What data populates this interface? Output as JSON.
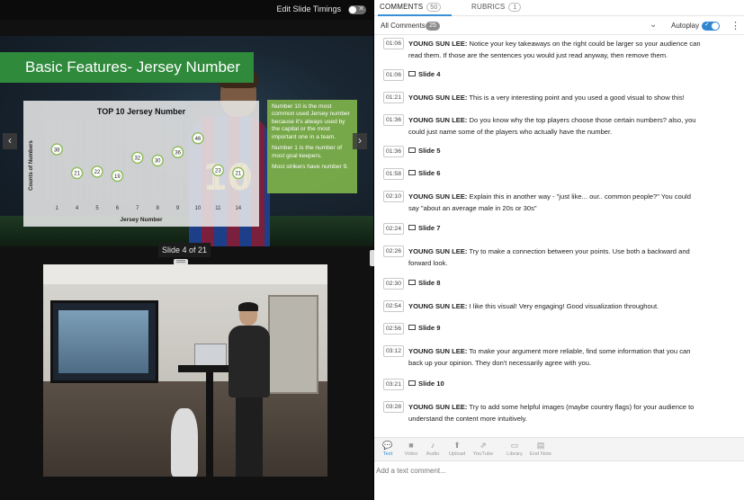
{
  "timings": {
    "label": "Edit Slide Timings",
    "toggle_mark": "✕"
  },
  "slide": {
    "title": "Basic Features- Jersey Number",
    "counter": "Slide 4 of 21",
    "jersey_number": "10",
    "notes": [
      "Number 10 is the most common used Jersey number because it's always used by the capital or the most important one in a team.",
      "Number 1 is the number of most goal keepers.",
      "Most strikers have number 9."
    ],
    "prev_arrow": "‹",
    "next_arrow": "›"
  },
  "chart_data": {
    "type": "scatter",
    "title": "TOP 10 Jersey Number",
    "xlabel": "Jersey Number",
    "ylabel": "Counts of Numbers",
    "categories": [
      "1",
      "4",
      "5",
      "6",
      "7",
      "8",
      "9",
      "10",
      "11",
      "14"
    ],
    "values": [
      38,
      21,
      22,
      19,
      32,
      30,
      36,
      46,
      23,
      21
    ],
    "ylim": [
      0,
      60
    ],
    "grid": true,
    "point_color": "#8fbc5a"
  },
  "right": {
    "tabs": [
      {
        "label": "COMMENTS",
        "count": "50"
      },
      {
        "label": "RUBRICS",
        "count": "1"
      }
    ],
    "filter": {
      "label": "All Comments",
      "count": "25",
      "caret": "⌄"
    },
    "autoplay": {
      "label": "Autoplay",
      "on": true
    },
    "more": "⋮",
    "comments": [
      {
        "time": "01:06",
        "author": "YOUNG SUN LEE:",
        "text": "Notice your key takeaways on the right could be larger so your audience can read them. If those are the sentences you would just read anyway, then remove them."
      },
      {
        "time": "01:06",
        "slide": "Slide 4"
      },
      {
        "time": "01:21",
        "author": "YOUNG SUN LEE:",
        "text": "This is a very interesting point and you used a good visual to show this!"
      },
      {
        "time": "01:36",
        "author": "YOUNG SUN LEE:",
        "text": "Do you know why the top players choose those certain numbers? also, you could just name some of the players who actually have the number."
      },
      {
        "time": "01:36",
        "slide": "Slide 5"
      },
      {
        "time": "01:58",
        "slide": "Slide 6"
      },
      {
        "time": "02:10",
        "author": "YOUNG SUN LEE:",
        "text": "Explain this in another way - \"just like... our.. common people?\" You could say \"about an average male in 20s or 30s\""
      },
      {
        "time": "02:24",
        "slide": "Slide 7"
      },
      {
        "time": "02:26",
        "author": "YOUNG SUN LEE:",
        "text": "Try to make a connection between your points. Use both a backward and forward look."
      },
      {
        "time": "02:30",
        "slide": "Slide 8"
      },
      {
        "time": "02:54",
        "author": "YOUNG SUN LEE:",
        "text": "I like this visual! Very engaging! Good visualization throughout."
      },
      {
        "time": "02:56",
        "slide": "Slide 9"
      },
      {
        "time": "03:12",
        "author": "YOUNG SUN LEE:",
        "text": "To make your argument more reliable, find some information that you can back up your opinion. They don't necessarily agree with you."
      },
      {
        "time": "03:21",
        "slide": "Slide 10"
      },
      {
        "time": "03:28",
        "author": "YOUNG SUN LEE:",
        "text": "Try to add some helpful images (maybe country flags) for your audience to understand the content more intuitively."
      }
    ],
    "toolbar": [
      {
        "label": "Text",
        "icon": "speech-bubble-icon",
        "glyph": "💬",
        "active": true
      },
      {
        "label": "Video",
        "icon": "video-camera-icon",
        "glyph": "■",
        "active": false
      },
      {
        "label": "Audio",
        "icon": "microphone-icon",
        "glyph": "♪",
        "active": false
      },
      {
        "label": "Upload",
        "icon": "upload-icon",
        "glyph": "⬆",
        "active": false
      },
      {
        "label": "YouTube",
        "icon": "external-link-icon",
        "glyph": "⇗",
        "active": false
      },
      {
        "label": "Library",
        "icon": "folder-icon",
        "glyph": "▭",
        "active": false
      },
      {
        "label": "End Note",
        "icon": "document-icon",
        "glyph": "▤",
        "active": false
      }
    ],
    "comment_placeholder": "Add a text comment..."
  }
}
